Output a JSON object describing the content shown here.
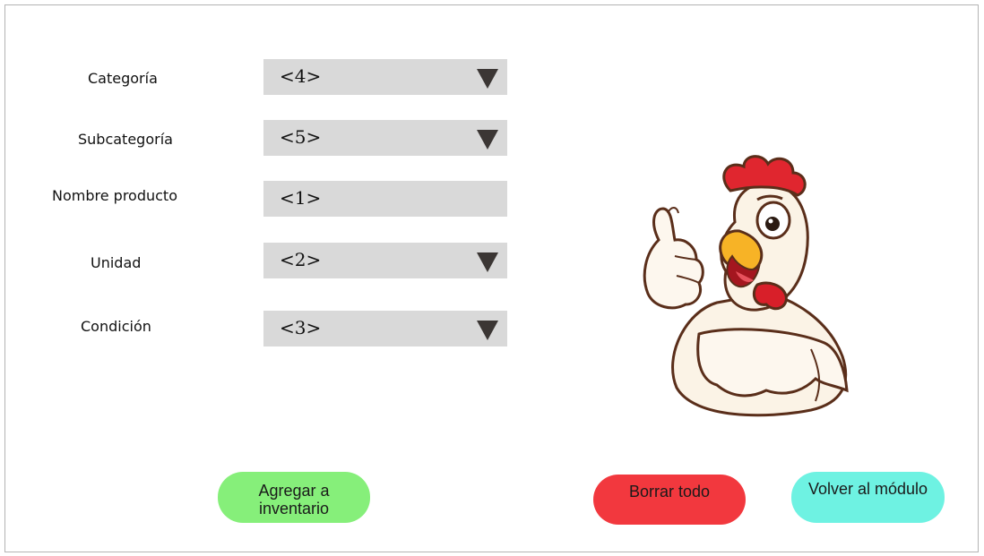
{
  "form": {
    "fields": [
      {
        "label": "Categoría",
        "value": "<4>",
        "type": "select"
      },
      {
        "label": "Subcategoría",
        "value": "<5>",
        "type": "select"
      },
      {
        "label": "Nombre producto",
        "value": "<1>",
        "type": "text"
      },
      {
        "label": "Unidad",
        "value": "<2>",
        "type": "select"
      },
      {
        "label": "Condición",
        "value": "<3>",
        "type": "select"
      }
    ]
  },
  "buttons": {
    "add_label": "Agregar a inventario",
    "clear_label": "Borrar todo",
    "back_label": "Volver al módulo"
  },
  "colors": {
    "field_bg": "#d9d9d9",
    "add_button": "#86ef7a",
    "clear_button": "#f2383e",
    "back_button": "#6ef2e2"
  },
  "mascot": {
    "icon": "rooster-thumbs-up-icon"
  }
}
